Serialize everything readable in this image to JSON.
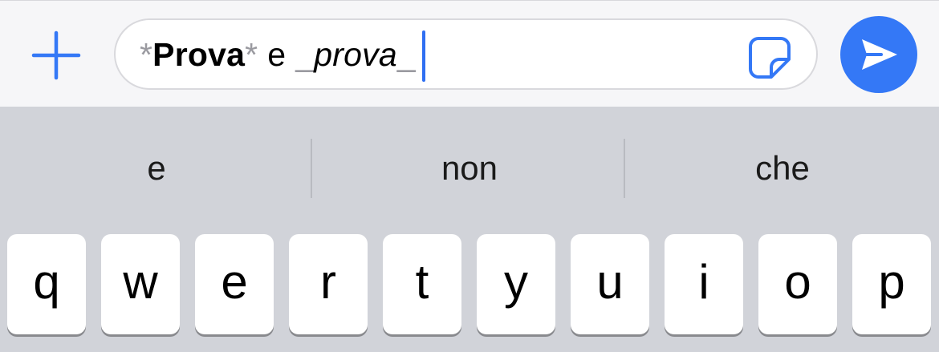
{
  "composer": {
    "add_icon": "plus-icon",
    "message": {
      "part1_open": "*",
      "part1_bold": "Prova",
      "part1_close": "*",
      "connector": "e",
      "part2_open": "_",
      "part2_italic": "prova",
      "part2_close": "_"
    },
    "sticker_icon": "sticker-icon",
    "send_icon": "paper-plane-icon",
    "accent_color": "#3478f6"
  },
  "predictions": [
    "e",
    "non",
    "che"
  ],
  "keyboard": {
    "row1": [
      "q",
      "w",
      "e",
      "r",
      "t",
      "y",
      "u",
      "i",
      "o",
      "p"
    ]
  }
}
